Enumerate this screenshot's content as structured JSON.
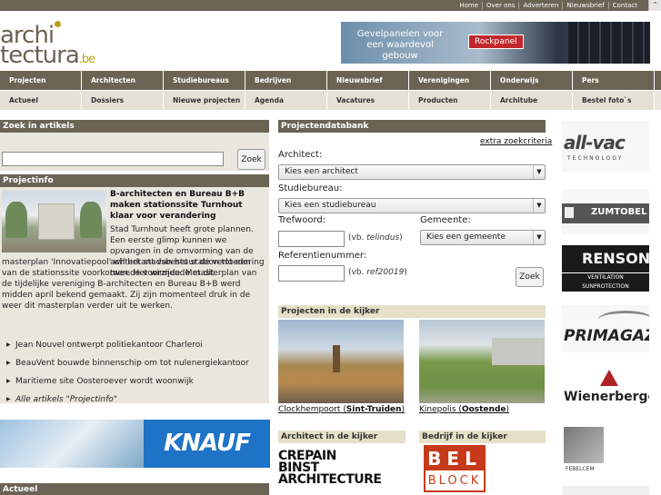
{
  "topbar": {
    "links": [
      "Home",
      "Over ons",
      "Adverteren",
      "Nieuwsbrief",
      "Contact"
    ],
    "scroll_up": "⌃"
  },
  "logo": {
    "line1": "archi",
    "line2": "tectura",
    "suffix": ".be"
  },
  "banner": {
    "text": "Gevelpanelen voor een waardevol gebouw",
    "brand": "Rockpanel"
  },
  "nav": {
    "row1": [
      "Projecten",
      "Architecten",
      "Studiebureaus",
      "Bedrijven",
      "Nieuwsbrief",
      "Verenigingen",
      "Onderwijs",
      "Pers"
    ],
    "row2": [
      "Actueel",
      "Dossiers",
      "Nieuwe projecten",
      "Agenda",
      "Vacatures",
      "Producten",
      "Architube",
      "Bestel foto`s"
    ]
  },
  "search": {
    "header": "Zoek in artikels",
    "value": "",
    "button": "Zoek"
  },
  "projectinfo": {
    "header": "Projectinfo",
    "title": "B-architecten en Bureau B+B maken stationssite Turnhout klaar voor verandering",
    "text1": "Stad Turnhout heeft grote plannen. Een eerste glimp kunnen we opvangen in de omvorming van de achterkant van het station tot een tweede voorzijde. Met dit",
    "text2": "masterplan 'Innovatiepool' wil het stadsbestuur de verloedering van de stationssite voorkomen. Het winnende masterplan van de tijdelijke vereniging B-architecten en Bureau B+B werd midden april bekend gemaakt. Zij zijn momenteel druk in de weer dit masterplan verder uit te werken.",
    "links": [
      "Jean Nouvel ontwerpt politiekantoor Charleroi",
      "BeauVent bouwde binnenschip om tot nulenergiekantoor",
      "Maritieme site Oosteroever wordt woonwijk"
    ],
    "all_link": "Alle artikels \"Projectinfo\""
  },
  "knauf": {
    "brand": "KNAUF"
  },
  "actueel": {
    "header": "Actueel"
  },
  "projectdb": {
    "header": "Projectendatabank",
    "extra": "extra zoekcriteria",
    "architect_label": "Architect:",
    "architect_value": "Kies een architect",
    "studie_label": "Studiebureau:",
    "studie_value": "Kies een studiebureau",
    "trefwoord_label": "Trefwoord:",
    "trefwoord_hint_prefix": "(vb. ",
    "trefwoord_hint_example": "telindus",
    "trefwoord_hint_suffix": ")",
    "gemeente_label": "Gemeente:",
    "gemeente_value": "Kies een gemeente",
    "ref_label": "Referentienummer:",
    "ref_hint_prefix": "(vb. ",
    "ref_hint_example": "ref20019",
    "ref_hint_suffix": ")",
    "button": "Zoek",
    "trefwoord_value": "",
    "ref_value": ""
  },
  "kijker": {
    "header": "Projecten in de kijker",
    "items": [
      {
        "name": "Clockhempoort",
        "city": "Sint-Truiden"
      },
      {
        "name": "Kinepolis",
        "city": "Oostende"
      }
    ]
  },
  "architect_kijker": {
    "header": "Architect in de kijker",
    "logo": "CREPAIN BINST ARCHITECTURE"
  },
  "bedrijf_kijker": {
    "header": "Bedrijf in de kijker",
    "logo_top": "BEL",
    "logo_bottom": "BLOCK"
  },
  "ads": {
    "allvac": "all-vac",
    "allvac_sub": "TECHNOLOGY",
    "zumtobel": "ZUMTOBEL",
    "renson": "RENSON",
    "renson_sub1": "VENTILATION",
    "renson_sub2": "SUNPROTECTION",
    "primagaz": "PRIMAGAZ",
    "wienerberger": "Wienerberger",
    "febelcem": "FEBELCEM"
  }
}
